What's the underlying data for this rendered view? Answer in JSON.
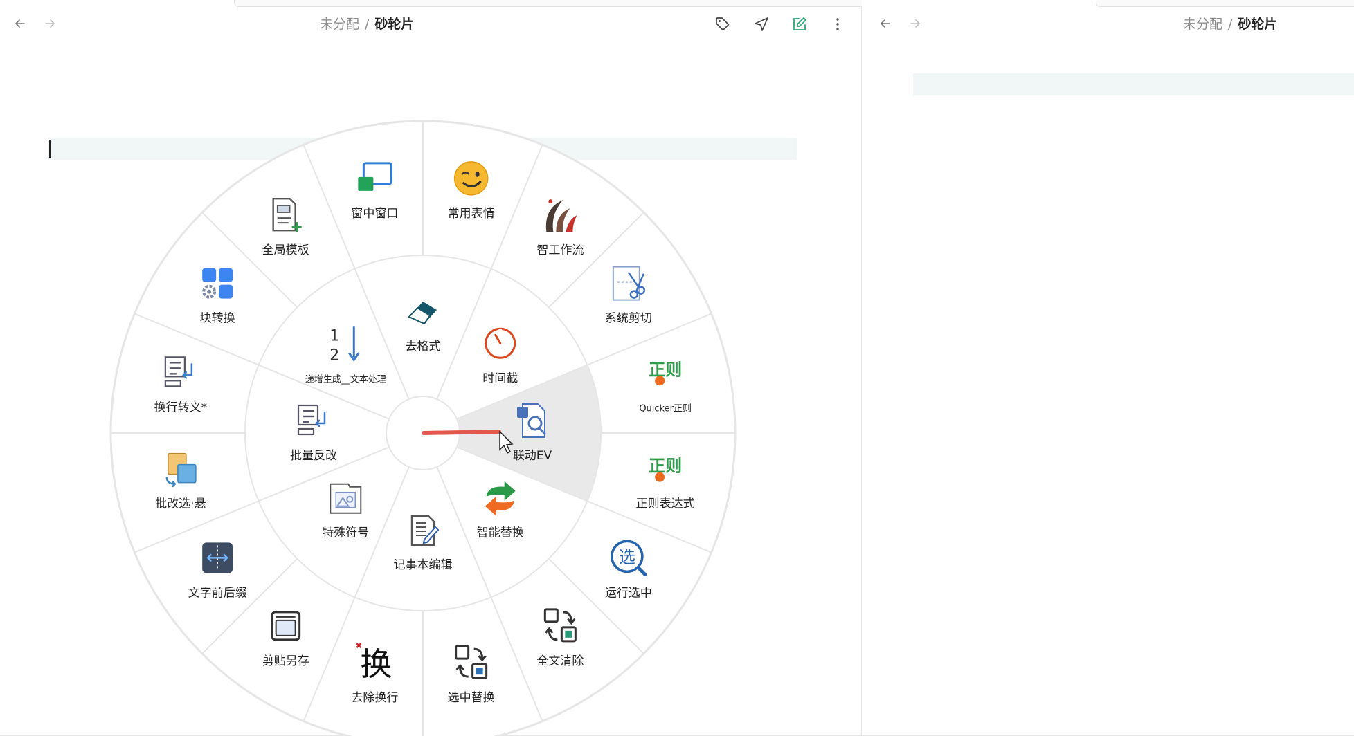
{
  "left_pane": {
    "breadcrumb": {
      "parent": "未分配",
      "separator": "/",
      "current": "砂轮片"
    },
    "toolbar": {
      "tag_icon": "tag-icon",
      "send_icon": "send-icon",
      "edit_icon": "edit-icon",
      "more_icon": "more-vert-icon"
    }
  },
  "right_pane": {
    "breadcrumb": {
      "parent": "未分配",
      "separator": "/",
      "current": "砂轮片"
    }
  },
  "colors": {
    "accent_green": "#2aa876",
    "wheel_highlight": "#e9e9e9",
    "wheel_line": "#e6e6e6",
    "gesture_red": "#e4574c"
  },
  "wheel": {
    "highlighted_item": "联动EV",
    "inner_ring": [
      {
        "label": "去格式",
        "icon": "eraser-icon"
      },
      {
        "label": "时间截",
        "icon": "timer-icon"
      },
      {
        "label": "联动EV",
        "icon": "link-search-icon"
      },
      {
        "label": "智能替换",
        "icon": "swap-arrows-icon"
      },
      {
        "label": "记事本编辑",
        "icon": "notepad-edit-icon"
      },
      {
        "label": "特殊符号",
        "icon": "image-frame-icon"
      },
      {
        "label": "批量反改",
        "icon": "text-wrap-icon"
      },
      {
        "label": "递增生成__文本处理",
        "icon": "sort-numeric-icon"
      }
    ],
    "outer_ring": [
      {
        "label": "常用表情",
        "icon": "wink-emoji-icon"
      },
      {
        "label": "智工作流",
        "icon": "workflow-brush-icon"
      },
      {
        "label": "系统剪切",
        "icon": "scissors-icon"
      },
      {
        "label": "Quicker正则",
        "icon": "regex-icon",
        "glyph": "正则"
      },
      {
        "label": "正则表达式",
        "icon": "regex-icon",
        "glyph": "正则"
      },
      {
        "label": "运行选中",
        "icon": "select-search-icon",
        "glyph": "选"
      },
      {
        "label": "全文清除",
        "icon": "replace-all-icon"
      },
      {
        "label": "选中替换",
        "icon": "replace-selection-icon"
      },
      {
        "label": "去除换行",
        "icon": "remove-newline-icon",
        "glyph": "换"
      },
      {
        "label": "剪贴另存",
        "icon": "clipboard-save-icon"
      },
      {
        "label": "文字前后缀",
        "icon": "prefix-suffix-icon"
      },
      {
        "label": "批改选·悬",
        "icon": "batch-edit-icon"
      },
      {
        "label": "换行转义*",
        "icon": "text-wrap-icon"
      },
      {
        "label": "块转换",
        "icon": "blocks-gear-icon"
      },
      {
        "label": "全局模板",
        "icon": "template-add-icon"
      },
      {
        "label": "窗中窗口",
        "icon": "window-in-window-icon"
      }
    ]
  }
}
